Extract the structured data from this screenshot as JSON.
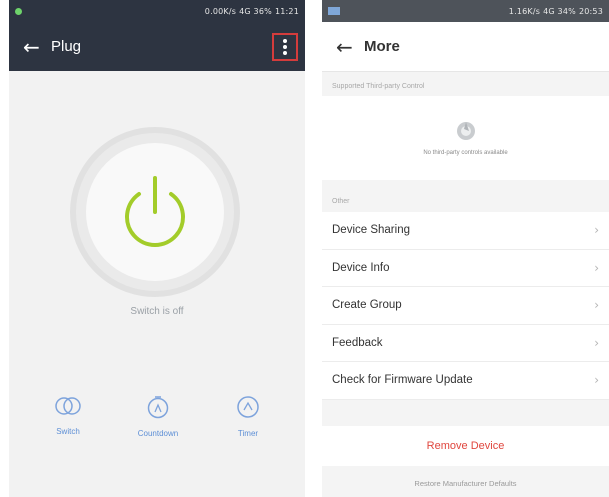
{
  "left_screen": {
    "statusbar": {
      "signal_text": "0.00K/s",
      "battery_text": "4G 36%",
      "time": "11:21"
    },
    "appbar": {
      "back_icon": "arrow-left-icon",
      "title": "Plug",
      "more_icon": "more-vertical-icon"
    },
    "power": {
      "icon": "power-icon",
      "color": "#a3cc2a"
    },
    "switch_status": "Switch is off",
    "tools": [
      {
        "label": "Switch",
        "icon": "switch-icon"
      },
      {
        "label": "Countdown",
        "icon": "timer-icon"
      },
      {
        "label": "Timer",
        "icon": "clock-icon"
      }
    ]
  },
  "right_screen": {
    "statusbar": {
      "signal_text": "1.16K/s",
      "battery_text": "4G 34%",
      "time": "20:53"
    },
    "appbar": {
      "back_icon": "arrow-left-icon",
      "title": "More"
    },
    "sections": {
      "ecosystem_label": "Supported Third-party Control",
      "ecosystem_icon": "alexa-icon",
      "ecosystem_note": "No third-party controls available",
      "other_label": "Other"
    },
    "menu": [
      {
        "label": "Device Sharing"
      },
      {
        "label": "Device Info"
      },
      {
        "label": "Create Group"
      },
      {
        "label": "Feedback"
      },
      {
        "label": "Check for Firmware Update"
      }
    ],
    "remove_device": "Remove Device",
    "restore_defaults": "Restore Manufacturer Defaults",
    "colors": {
      "danger": "#e0463e",
      "accent": "#5d8fd6"
    }
  }
}
